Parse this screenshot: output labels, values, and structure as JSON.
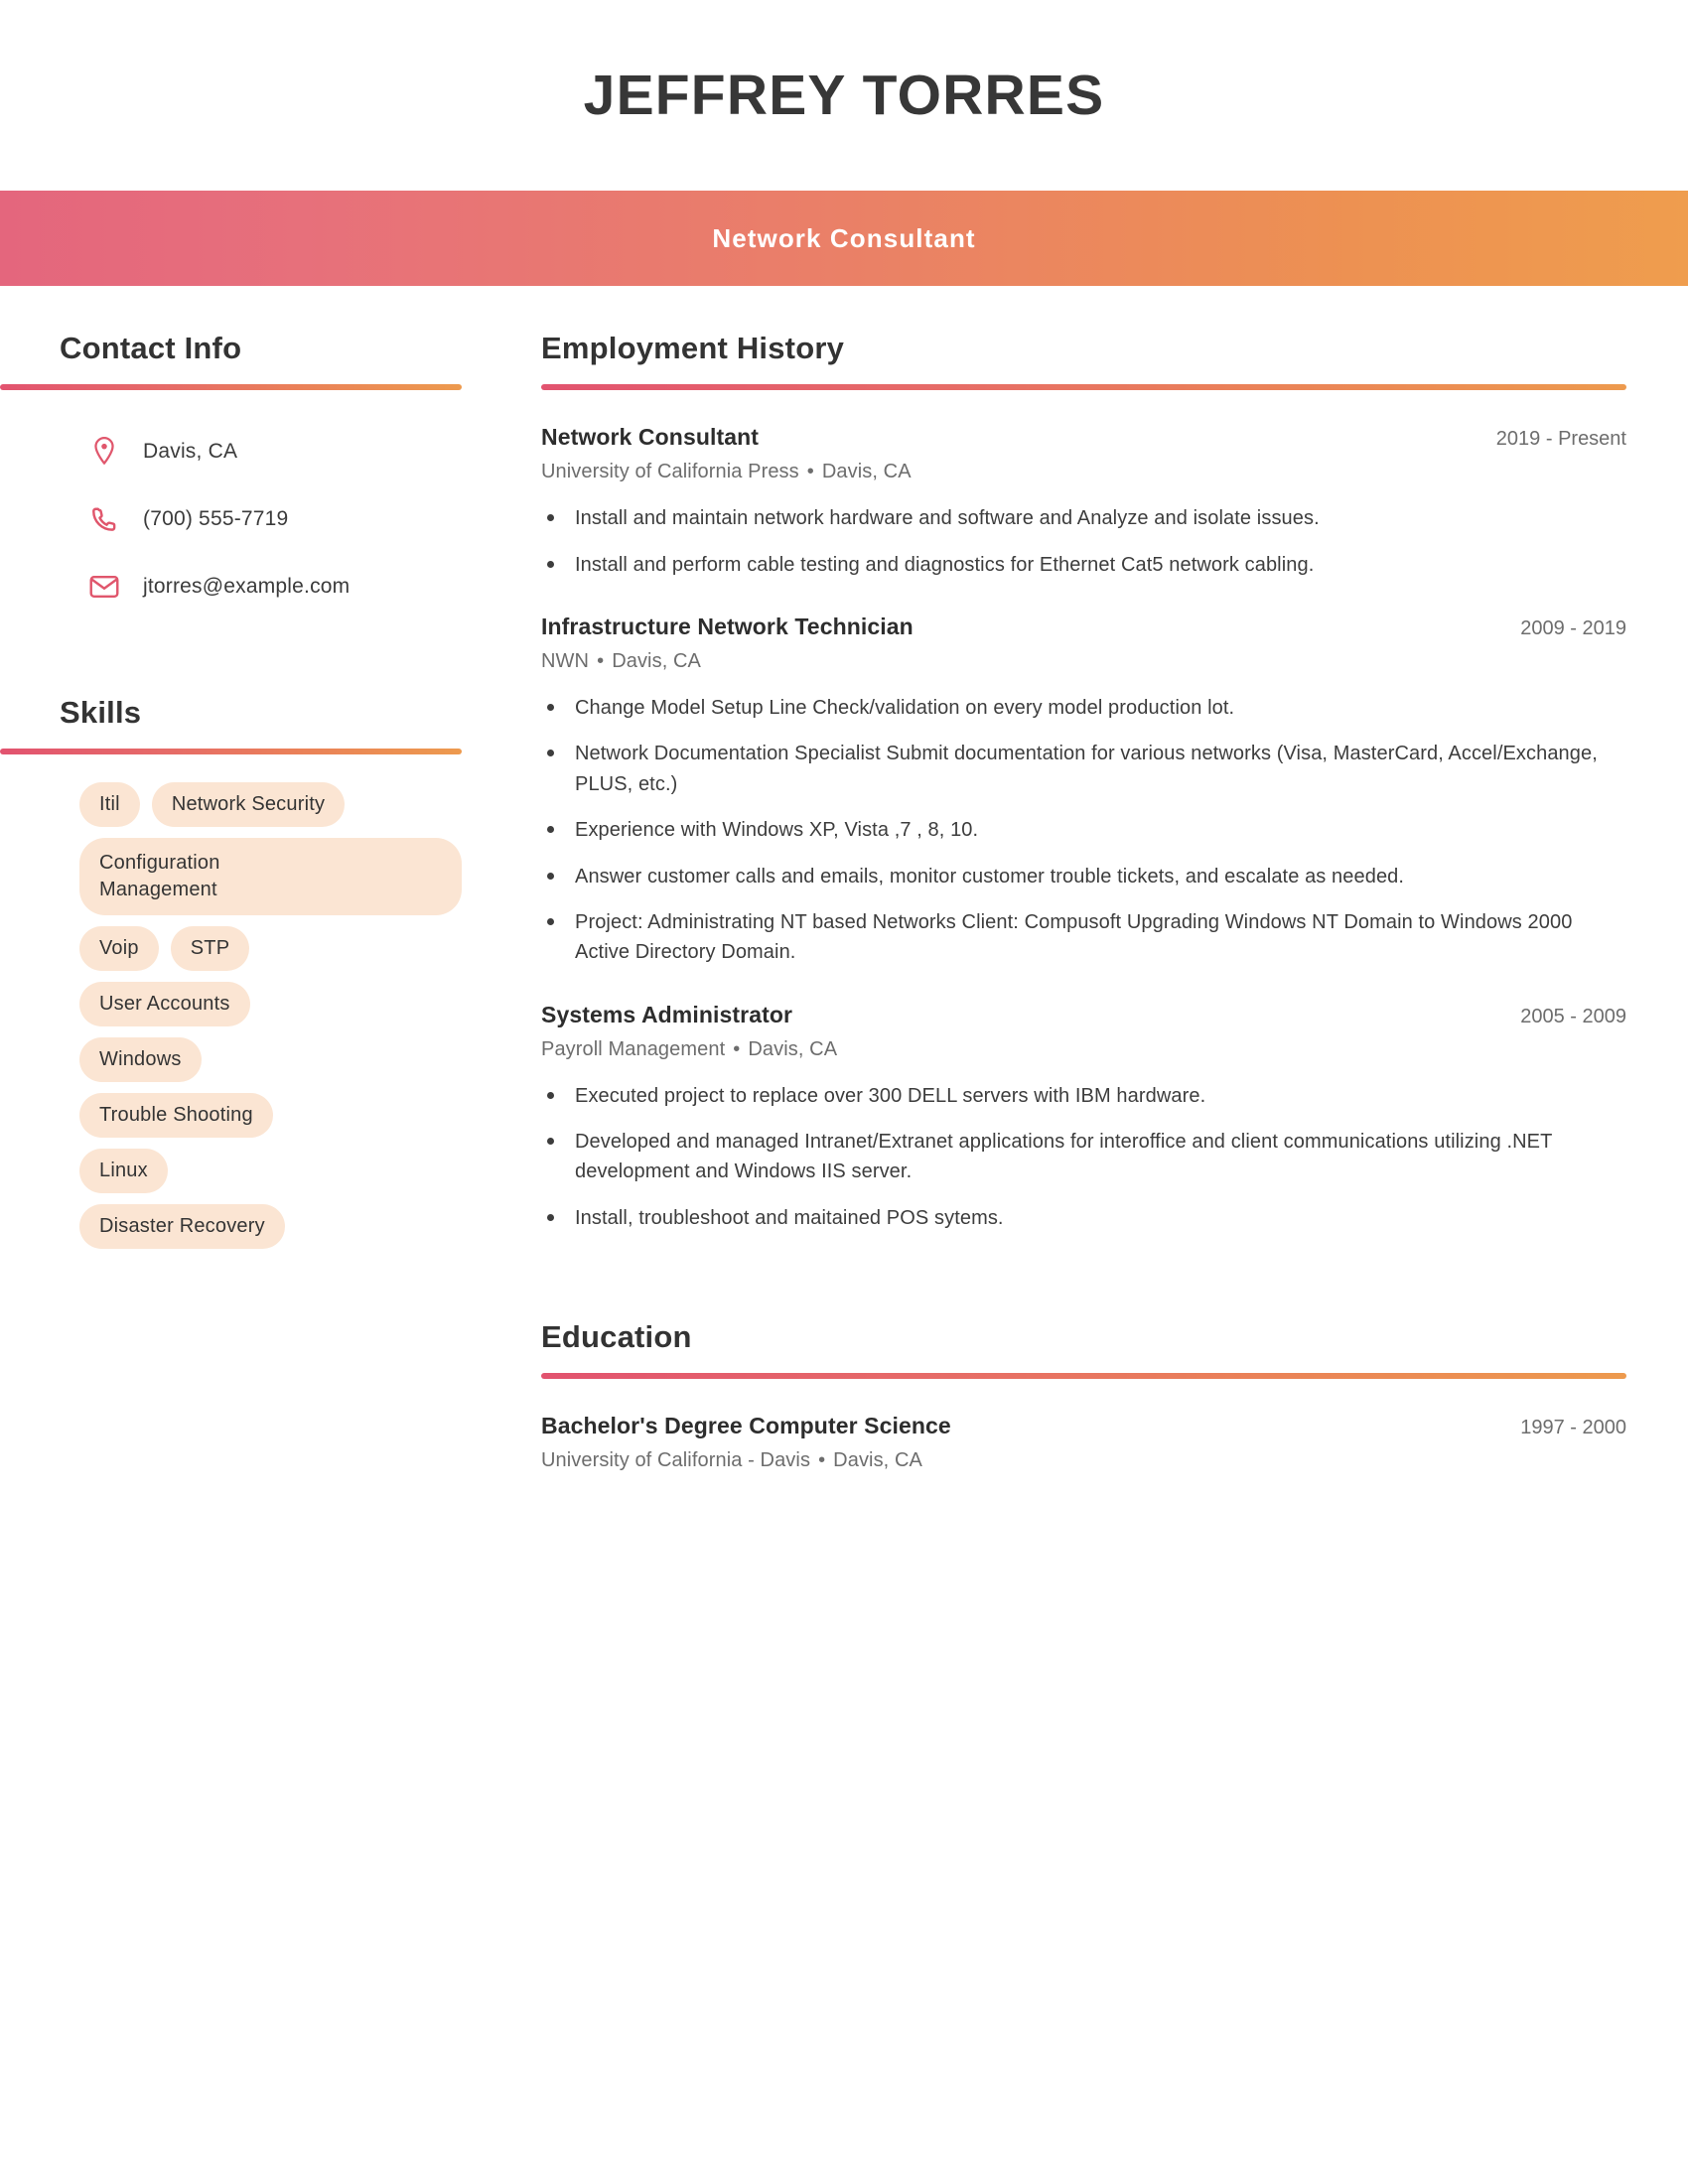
{
  "header": {
    "name": "JEFFREY TORRES",
    "job_title": "Network Consultant",
    "gradient_start": "#e4667d",
    "gradient_end": "#ef9d4e"
  },
  "theme": {
    "accent_pink": "#e2536f",
    "accent_orange": "#ed9a4e",
    "chip_bg": "#fbe5d3",
    "icon_color": "#e0566c",
    "text_dark": "#333333",
    "text_muted": "#6d6d6d"
  },
  "contact": {
    "heading": "Contact Info",
    "items": [
      {
        "icon": "location-pin-icon",
        "value": "Davis, CA"
      },
      {
        "icon": "phone-icon",
        "value": "(700) 555-7719"
      },
      {
        "icon": "email-icon",
        "value": "jtorres@example.com"
      }
    ]
  },
  "skills": {
    "heading": "Skills",
    "rows": [
      {
        "items": [
          "Itil",
          "Network Security"
        ],
        "wide": false
      },
      {
        "items": [
          "Configuration\nManagement"
        ],
        "wide": true
      },
      {
        "items": [
          "Voip",
          "STP"
        ],
        "wide": false
      },
      {
        "items": [
          "User Accounts"
        ],
        "wide": false
      },
      {
        "items": [
          "Windows"
        ],
        "wide": false
      },
      {
        "items": [
          "Trouble Shooting"
        ],
        "wide": false
      },
      {
        "items": [
          "Linux"
        ],
        "wide": false
      },
      {
        "items": [
          "Disaster Recovery"
        ],
        "wide": false
      }
    ]
  },
  "employment": {
    "heading": "Employment History",
    "entries": [
      {
        "role": "Network Consultant",
        "dates": "2019 - Present",
        "company": "University of California Press",
        "separator": "•",
        "location": "Davis, CA",
        "bullets": [
          "Install and maintain network hardware and software and Analyze and isolate issues.",
          "Install and perform cable testing and diagnostics for Ethernet Cat5 network cabling."
        ]
      },
      {
        "role": "Infrastructure Network Technician",
        "dates": "2009 - 2019",
        "company": "NWN",
        "separator": "•",
        "location": "Davis, CA",
        "bullets": [
          "Change Model Setup Line Check/validation on every model production lot.",
          "Network Documentation Specialist Submit documentation for various networks (Visa, MasterCard, Accel/Exchange, PLUS, etc.)",
          "Experience with Windows XP, Vista ,7 , 8, 10.",
          "Answer customer calls and emails, monitor customer trouble tickets, and escalate as needed.",
          "Project: Administrating NT based Networks Client: Compusoft Upgrading Windows NT Domain to Windows 2000 Active Directory Domain."
        ]
      },
      {
        "role": "Systems Administrator",
        "dates": "2005 - 2009",
        "company": "Payroll Management",
        "separator": "•",
        "location": "Davis, CA",
        "bullets": [
          "Executed project to replace over 300 DELL servers with IBM hardware.",
          "Developed and managed Intranet/Extranet applications for interoffice and client communications utilizing .NET development and Windows IIS server.",
          "Install, troubleshoot and maitained POS sytems."
        ]
      }
    ]
  },
  "education": {
    "heading": "Education",
    "entries": [
      {
        "degree": "Bachelor's Degree Computer Science",
        "dates": "1997 - 2000",
        "school": "University of California - Davis",
        "separator": "•",
        "location": "Davis, CA"
      }
    ]
  }
}
